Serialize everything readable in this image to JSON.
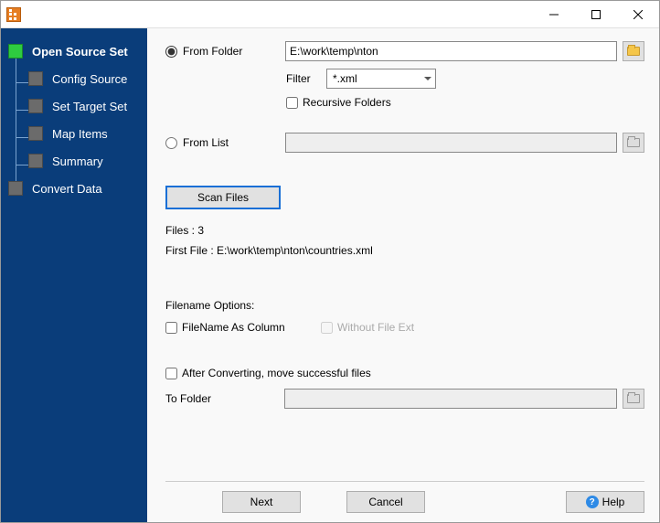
{
  "titlebar": {
    "title": ""
  },
  "sidebar": {
    "items": [
      {
        "label": "Open Source Set"
      },
      {
        "label": "Config Source"
      },
      {
        "label": "Set Target Set"
      },
      {
        "label": "Map Items"
      },
      {
        "label": "Summary"
      },
      {
        "label": "Convert Data"
      }
    ]
  },
  "source": {
    "from_folder_label": "From Folder",
    "folder_path": "E:\\work\\temp\\nton",
    "filter_label": "Filter",
    "filter_value": "*.xml",
    "recursive_label": "Recursive Folders",
    "from_list_label": "From List",
    "list_path": ""
  },
  "scan": {
    "button": "Scan Files",
    "files_count": "Files : 3",
    "first_file": "First File : E:\\work\\temp\\nton\\countries.xml"
  },
  "filename_opts": {
    "heading": "Filename Options:",
    "as_column": "FileName As Column",
    "without_ext": "Without File Ext"
  },
  "after": {
    "move_label": "After Converting, move successful files",
    "to_folder_label": "To Folder",
    "to_folder_path": ""
  },
  "footer": {
    "next": "Next",
    "cancel": "Cancel",
    "help": "Help"
  }
}
